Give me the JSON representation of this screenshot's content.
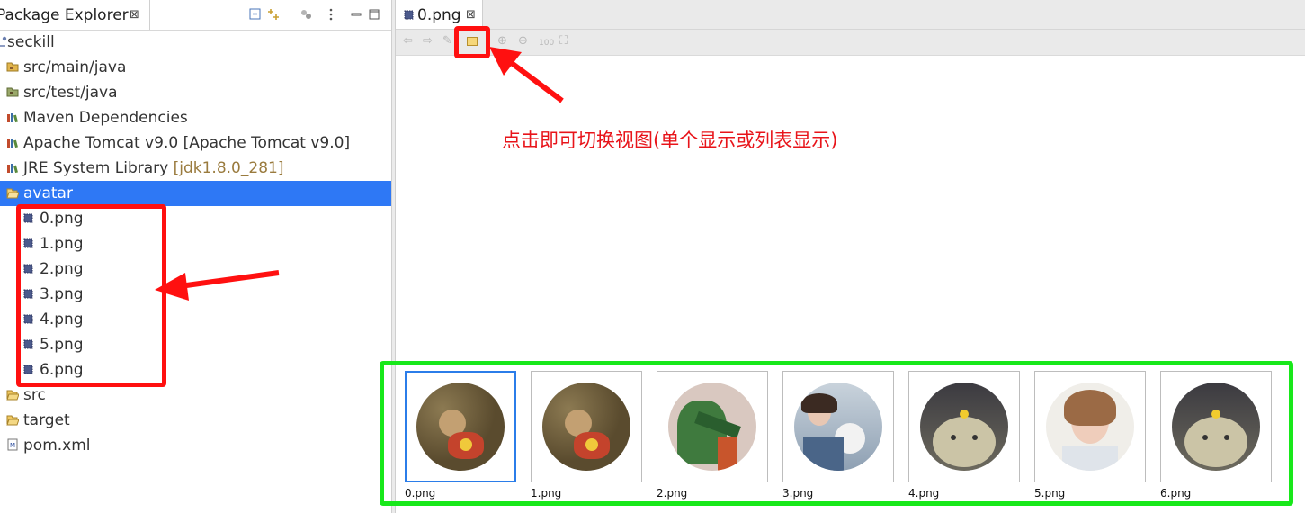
{
  "explorer": {
    "title": "Package Explorer",
    "close_glyph": "⊠",
    "items": [
      {
        "label": "seckill",
        "decor": "",
        "icon": "project-icon"
      },
      {
        "label": "src/main/java",
        "decor": "",
        "icon": "source-folder-icon"
      },
      {
        "label": "src/test/java",
        "decor": "",
        "icon": "source-folder-icon"
      },
      {
        "label": "Maven Dependencies",
        "decor": "",
        "icon": "library-icon"
      },
      {
        "label": "Apache Tomcat v9.0 [Apache Tomcat v9.0]",
        "decor": "",
        "icon": "library-icon"
      },
      {
        "label": "JRE System Library ",
        "decor": "[jdk1.8.0_281]",
        "icon": "library-icon"
      },
      {
        "label": "avatar",
        "decor": "",
        "icon": "folder-open-icon"
      },
      {
        "label": "0.png",
        "decor": "",
        "icon": "image-file-icon"
      },
      {
        "label": "1.png",
        "decor": "",
        "icon": "image-file-icon"
      },
      {
        "label": "2.png",
        "decor": "",
        "icon": "image-file-icon"
      },
      {
        "label": "3.png",
        "decor": "",
        "icon": "image-file-icon"
      },
      {
        "label": "4.png",
        "decor": "",
        "icon": "image-file-icon"
      },
      {
        "label": "5.png",
        "decor": "",
        "icon": "image-file-icon"
      },
      {
        "label": "6.png",
        "decor": "",
        "icon": "image-file-icon"
      },
      {
        "label": "src",
        "decor": "",
        "icon": "folder-icon"
      },
      {
        "label": "target",
        "decor": "",
        "icon": "folder-icon"
      },
      {
        "label": "pom.xml",
        "decor": "",
        "icon": "maven-file-icon"
      }
    ],
    "selected_item": "avatar"
  },
  "editor": {
    "tab_label": "0.png",
    "close_glyph": "⊠",
    "zoom_label": "100",
    "annotation": "点击即可切换视图(单个显示或列表显示)",
    "thumbnails": [
      {
        "label": "0.png",
        "selected": true
      },
      {
        "label": "1.png",
        "selected": false
      },
      {
        "label": "2.png",
        "selected": false
      },
      {
        "label": "3.png",
        "selected": false
      },
      {
        "label": "4.png",
        "selected": false
      },
      {
        "label": "5.png",
        "selected": false
      },
      {
        "label": "6.png",
        "selected": false
      }
    ]
  },
  "colors": {
    "selection": "#2e78f5",
    "annotation_red": "#ff1010",
    "annotation_green": "#18e81a",
    "thumb_selected_border": "#2b7de9"
  }
}
